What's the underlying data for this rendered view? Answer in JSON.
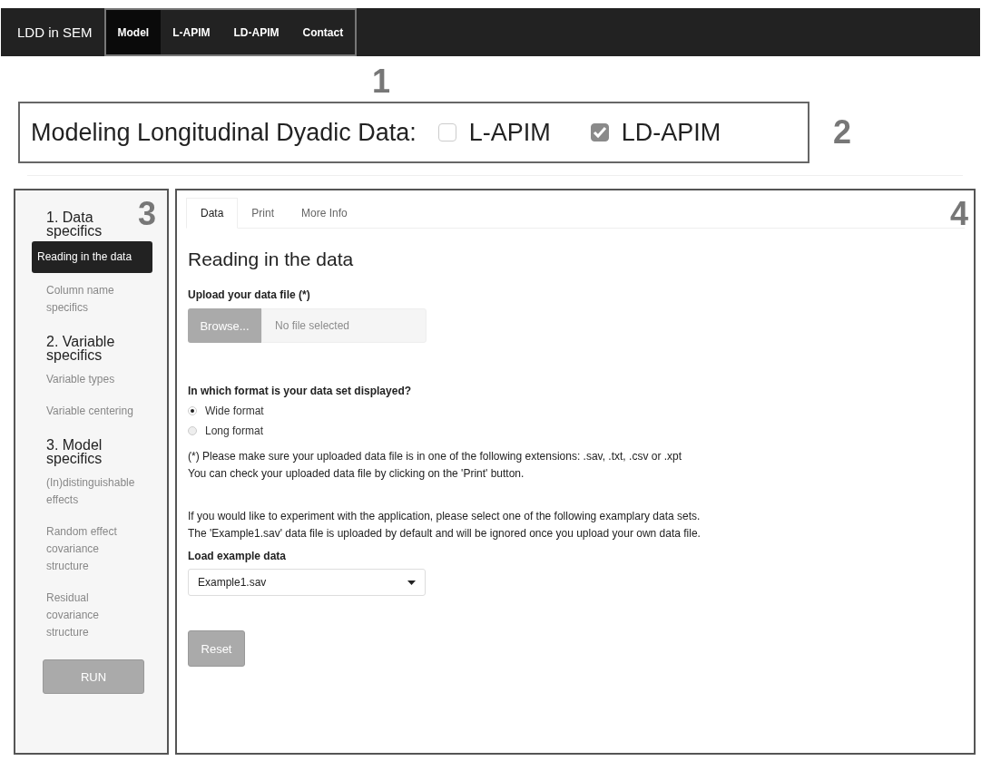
{
  "navbar": {
    "brand": "LDD in SEM",
    "items": [
      {
        "label": "Model",
        "selected": true
      },
      {
        "label": "L-APIM",
        "selected": false
      },
      {
        "label": "LD-APIM",
        "selected": false
      },
      {
        "label": "Contact",
        "selected": false
      }
    ],
    "callout": "1"
  },
  "header": {
    "title": "Modeling Longitudinal Dyadic Data:",
    "options": [
      {
        "label": "L-APIM",
        "checked": false
      },
      {
        "label": "LD-APIM",
        "checked": true
      }
    ],
    "callout": "2"
  },
  "sidebar": {
    "callout": "3",
    "sections": [
      {
        "title": "1. Data specifics",
        "items": [
          {
            "label": "Reading in the data",
            "selected": true
          },
          {
            "label": "Column name specifics",
            "selected": false
          }
        ]
      },
      {
        "title": "2. Variable specifics",
        "items": [
          {
            "label": "Variable types",
            "selected": false
          },
          {
            "label": "Variable centering",
            "selected": false
          }
        ]
      },
      {
        "title": "3. Model specifics",
        "items": [
          {
            "label": "(In)distinguishable effects",
            "selected": false
          },
          {
            "label": "Random effect covariance structure",
            "selected": false
          },
          {
            "label": "Residual covariance structure",
            "selected": false
          }
        ]
      }
    ],
    "run_button": "RUN"
  },
  "main": {
    "callout": "4",
    "tabs": [
      {
        "label": "Data",
        "selected": true
      },
      {
        "label": "Print",
        "selected": false
      },
      {
        "label": "More Info",
        "selected": false
      }
    ],
    "heading": "Reading in the data",
    "upload": {
      "label": "Upload your data file (*)",
      "button": "Browse...",
      "placeholder": "No file selected"
    },
    "format": {
      "question": "In which format is your data set displayed?",
      "options": [
        {
          "label": "Wide format",
          "selected": true
        },
        {
          "label": "Long format",
          "selected": false
        }
      ]
    },
    "notes": [
      "(*) Please make sure your uploaded data file is in one of the following extensions: .sav, .txt, .csv or .xpt",
      "You can check your uploaded data file by clicking on the 'Print' button."
    ],
    "info": [
      "If you would like to experiment with the application, please select one of the following examplary data sets.",
      "The 'Example1.sav' data file is uploaded by default and will be ignored once you upload your own data file."
    ],
    "example": {
      "label": "Load example data",
      "value": "Example1.sav"
    },
    "reset_button": "Reset"
  }
}
